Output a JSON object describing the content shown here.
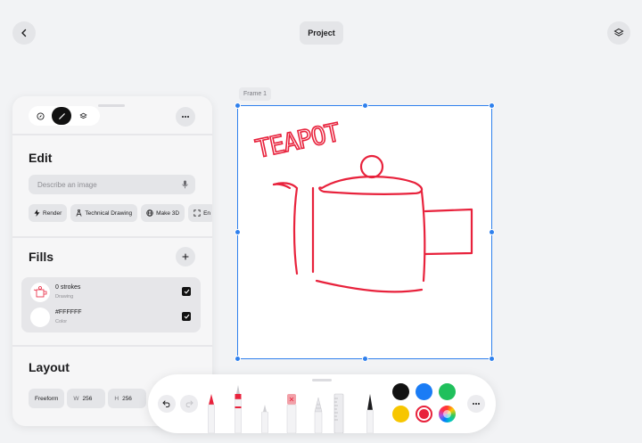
{
  "header": {
    "project_label": "Project"
  },
  "canvas": {
    "frame_label": "Frame 1",
    "drawing_text": "TEAPOT",
    "stroke_color": "#e8223c"
  },
  "panel": {
    "edit": {
      "title": "Edit",
      "placeholder": "Describe an image",
      "chips": [
        {
          "label": "Render",
          "icon": "bolt-icon"
        },
        {
          "label": "Technical Drawing",
          "icon": "compass-icon"
        },
        {
          "label": "Make 3D",
          "icon": "globe-icon"
        },
        {
          "label": "En",
          "icon": "expand-icon"
        }
      ]
    },
    "fills": {
      "title": "Fills",
      "items": [
        {
          "name": "0 strokes",
          "sub": "Drawing"
        },
        {
          "name": "#FFFFFF",
          "sub": "Color"
        }
      ]
    },
    "layout": {
      "title": "Layout",
      "mode": "Freeform",
      "w_label": "W",
      "w_value": "256",
      "h_label": "H",
      "h_value": "256"
    }
  },
  "toolbar": {
    "colors": [
      "#111111",
      "#1a7cf5",
      "#20c05c",
      "#f7c600",
      "#e8223c",
      "rainbow"
    ],
    "selected_color": "#e8223c"
  },
  "accent": "#2f80ed"
}
